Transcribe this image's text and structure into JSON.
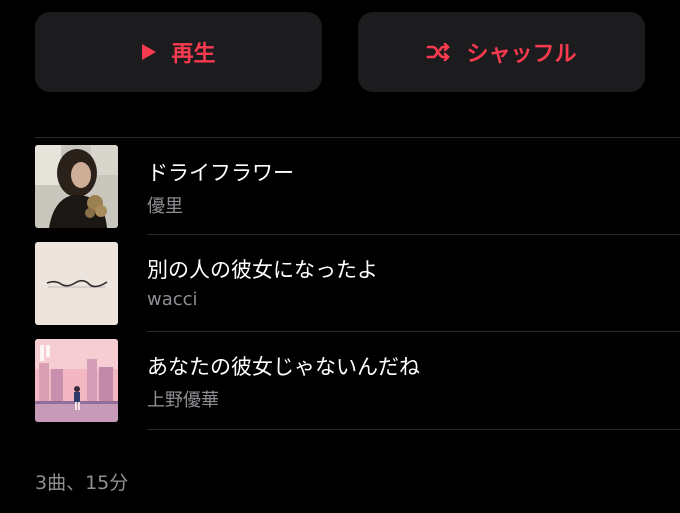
{
  "controls": {
    "play_label": "再生",
    "shuffle_label": "シャッフル",
    "accent_color": "#fa3a4f"
  },
  "tracks": [
    {
      "title": "ドライフラワー",
      "artist": "優里",
      "artwork_icon": "dried-flower-cover-art"
    },
    {
      "title": "別の人の彼女になったよ",
      "artist": "wacci",
      "artwork_icon": "wacci-cover-art"
    },
    {
      "title": "あなたの彼女じゃないんだね",
      "artist": "上野優華",
      "artwork_icon": "city-sunset-cover-art"
    }
  ],
  "summary": "3曲、15分"
}
